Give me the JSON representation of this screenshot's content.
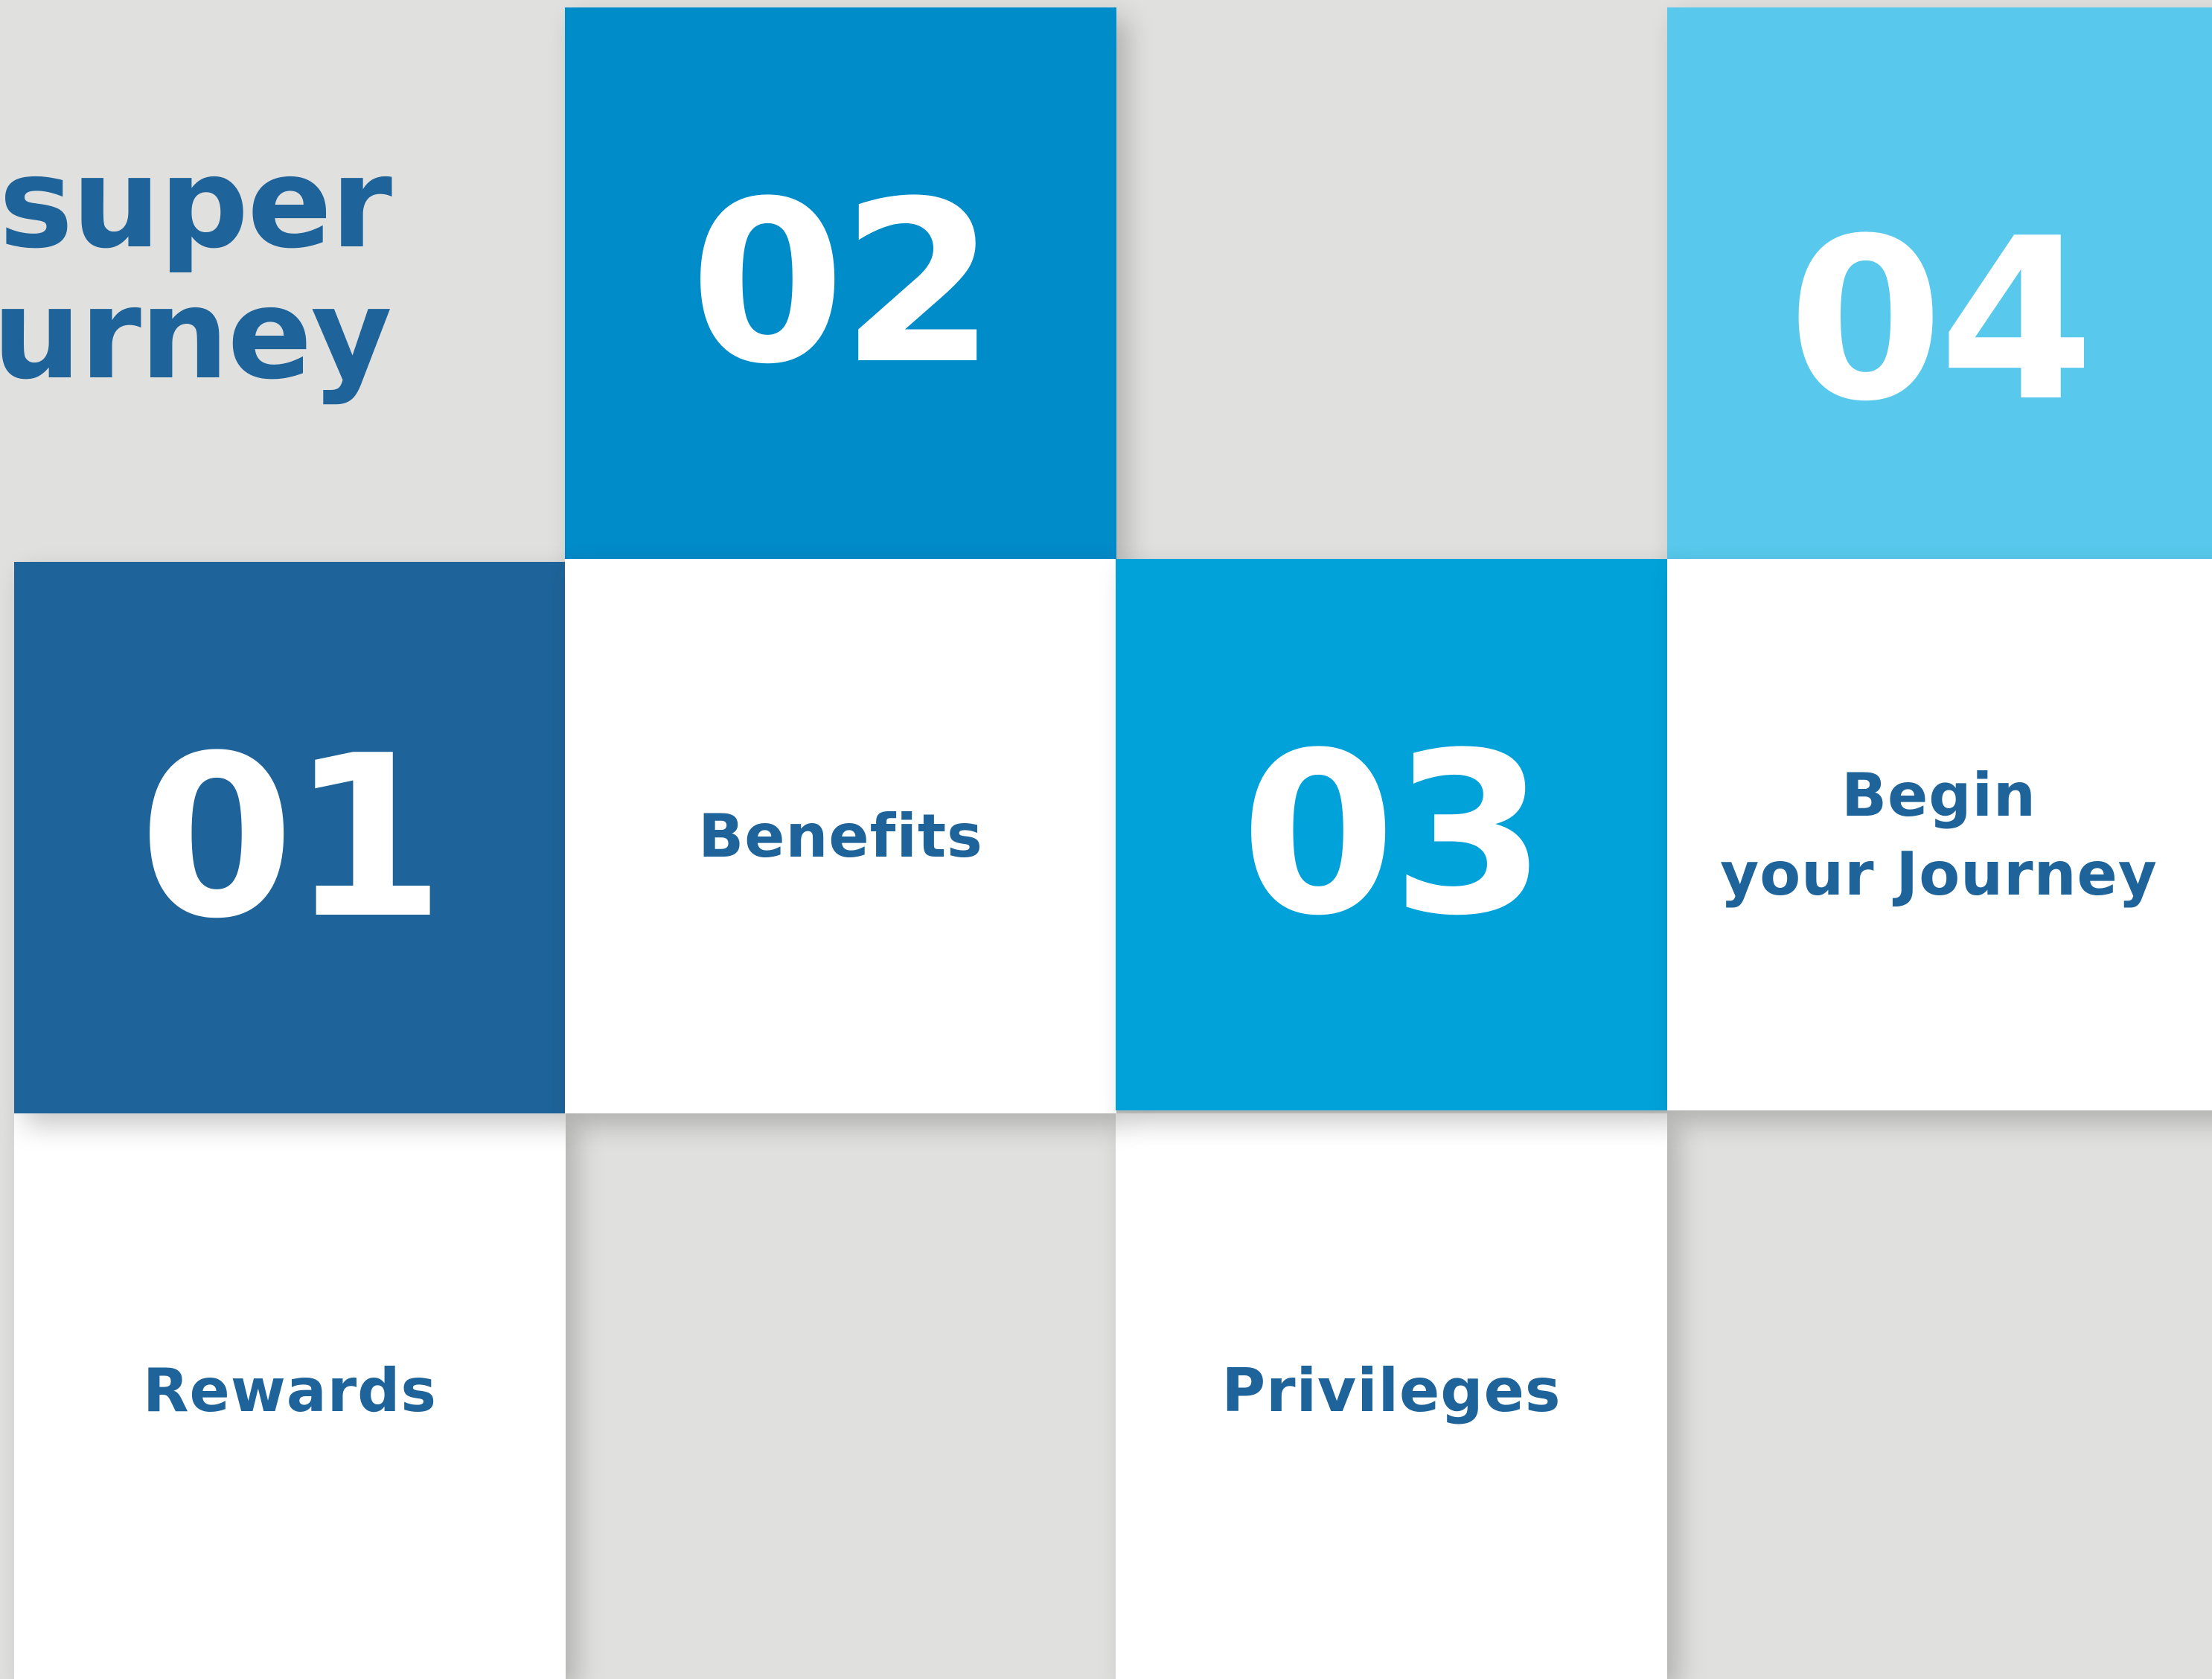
{
  "colors": {
    "background": "#e0e0df",
    "navy": "#1e6399",
    "blue": "#008bc9",
    "bright_blue": "#00a2d9",
    "light_blue": "#58c9ec",
    "white": "#ffffff",
    "text": "#1e6399"
  },
  "headline": {
    "line1": "super",
    "line2": "urney"
  },
  "steps": [
    {
      "number": "01",
      "label": "Rewards"
    },
    {
      "number": "02",
      "label": "Benefits"
    },
    {
      "number": "03",
      "label": "Privileges"
    },
    {
      "number": "04",
      "label_line1": "Begin",
      "label_line2": "your Journey"
    }
  ]
}
